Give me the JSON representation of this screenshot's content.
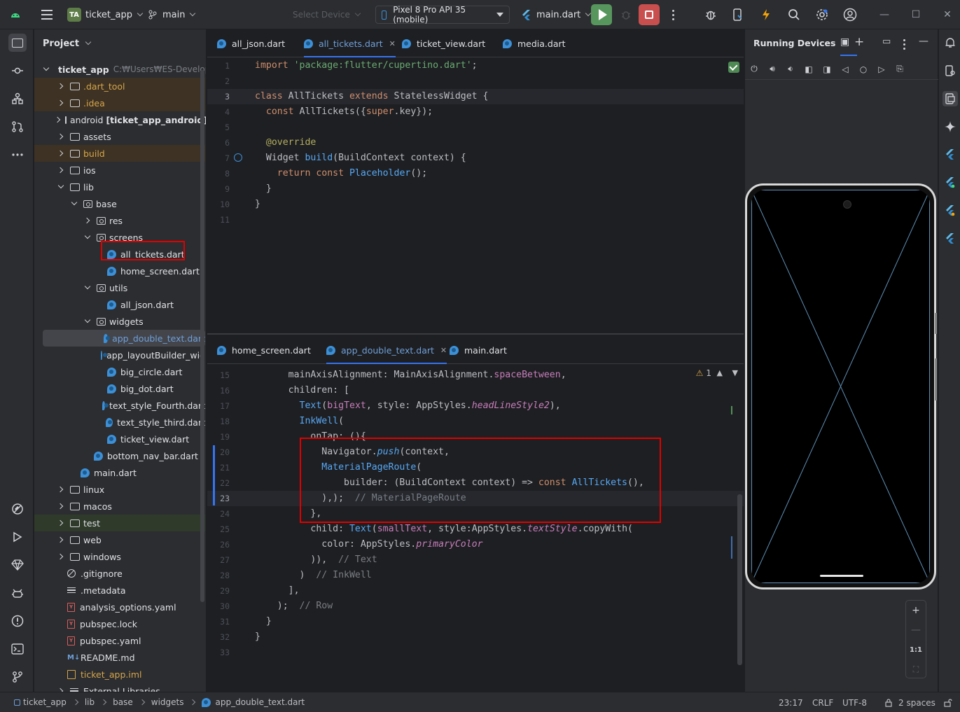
{
  "titlebar": {
    "project_badge": "TA",
    "project_name": "ticket_app",
    "branch": "main",
    "select_device_placeholder": "Select Device",
    "device": "Pixel 8 Pro API 35 (mobile)",
    "run_config": "main.dart"
  },
  "project_panel": {
    "title": "Project",
    "tree": [
      {
        "label": "ticket_app",
        "extra": "C:₩Users₩ES-Develope",
        "depth": 0,
        "arrow": "d",
        "icon": "flutter"
      },
      {
        "label": ".dart_tool",
        "depth": 1,
        "arrow": "r",
        "icon": "folder",
        "style": "excluded"
      },
      {
        "label": ".idea",
        "depth": 1,
        "arrow": "r",
        "icon": "folder",
        "style": "excluded"
      },
      {
        "label": "android",
        "bold": "[ticket_app_android]",
        "depth": 1,
        "arrow": "r",
        "icon": "folder"
      },
      {
        "label": "assets",
        "depth": 1,
        "arrow": "r",
        "icon": "folder"
      },
      {
        "label": "build",
        "depth": 1,
        "arrow": "r",
        "icon": "folder",
        "style": "excluded"
      },
      {
        "label": "ios",
        "depth": 1,
        "arrow": "r",
        "icon": "folder"
      },
      {
        "label": "lib",
        "depth": 1,
        "arrow": "d",
        "icon": "folder"
      },
      {
        "label": "base",
        "depth": 2,
        "arrow": "d",
        "icon": "pkg"
      },
      {
        "label": "res",
        "depth": 3,
        "arrow": "r",
        "icon": "pkg"
      },
      {
        "label": "screens",
        "depth": 3,
        "arrow": "d",
        "icon": "pkg"
      },
      {
        "label": "all_tickets.dart",
        "depth": 4,
        "arrow": "none",
        "icon": "dart"
      },
      {
        "label": "home_screen.dart",
        "depth": 4,
        "arrow": "none",
        "icon": "dart"
      },
      {
        "label": "utils",
        "depth": 3,
        "arrow": "d",
        "icon": "pkg"
      },
      {
        "label": "all_json.dart",
        "depth": 4,
        "arrow": "none",
        "icon": "dart"
      },
      {
        "label": "widgets",
        "depth": 3,
        "arrow": "d",
        "icon": "pkg"
      },
      {
        "label": "app_double_text.dart",
        "depth": 4,
        "arrow": "none",
        "icon": "dart",
        "style": "selected"
      },
      {
        "label": "app_layoutBuilder_wid",
        "depth": 4,
        "arrow": "none",
        "icon": "dart"
      },
      {
        "label": "big_circle.dart",
        "depth": 4,
        "arrow": "none",
        "icon": "dart"
      },
      {
        "label": "big_dot.dart",
        "depth": 4,
        "arrow": "none",
        "icon": "dart"
      },
      {
        "label": "text_style_Fourth.dart",
        "depth": 4,
        "arrow": "none",
        "icon": "dart"
      },
      {
        "label": "text_style_third.dart",
        "depth": 4,
        "arrow": "none",
        "icon": "dart"
      },
      {
        "label": "ticket_view.dart",
        "depth": 4,
        "arrow": "none",
        "icon": "dart"
      },
      {
        "label": "bottom_nav_bar.dart",
        "depth": 3,
        "arrow": "none",
        "icon": "dart"
      },
      {
        "label": "main.dart",
        "depth": 2,
        "arrow": "none",
        "icon": "dart"
      },
      {
        "label": "linux",
        "depth": 1,
        "arrow": "r",
        "icon": "folder"
      },
      {
        "label": "macos",
        "depth": 1,
        "arrow": "r",
        "icon": "folder"
      },
      {
        "label": "test",
        "depth": 1,
        "arrow": "r",
        "icon": "folder",
        "style": "test"
      },
      {
        "label": "web",
        "depth": 1,
        "arrow": "r",
        "icon": "folder"
      },
      {
        "label": "windows",
        "depth": 1,
        "arrow": "r",
        "icon": "folder"
      },
      {
        "label": ".gitignore",
        "depth": 1,
        "arrow": "none",
        "icon": "noentry"
      },
      {
        "label": ".metadata",
        "depth": 1,
        "arrow": "none",
        "icon": "lines"
      },
      {
        "label": "analysis_options.yaml",
        "depth": 1,
        "arrow": "none",
        "icon": "yaml"
      },
      {
        "label": "pubspec.lock",
        "depth": 1,
        "arrow": "none",
        "icon": "yaml"
      },
      {
        "label": "pubspec.yaml",
        "depth": 1,
        "arrow": "none",
        "icon": "yaml"
      },
      {
        "label": "README.md",
        "depth": 1,
        "arrow": "none",
        "icon": "md"
      },
      {
        "label": "ticket_app.iml",
        "depth": 1,
        "arrow": "none",
        "icon": "iml",
        "style": "orange"
      },
      {
        "label": "External Libraries",
        "depth": 1,
        "arrow": "r",
        "icon": "lines"
      }
    ]
  },
  "top_editor": {
    "tabs": [
      {
        "label": "all_json.dart",
        "active": false
      },
      {
        "label": "all_tickets.dart",
        "active": true
      },
      {
        "label": "ticket_view.dart",
        "active": false
      },
      {
        "label": "media.dart",
        "active": false
      }
    ],
    "current_line": 3,
    "lines": [
      {
        "n": "1",
        "code": [
          [
            "k",
            "import "
          ],
          [
            "s",
            "'package:flutter/cupertino.dart'"
          ],
          [
            "t",
            ";"
          ]
        ]
      },
      {
        "n": "2",
        "code": []
      },
      {
        "n": "3",
        "code": [
          [
            "k",
            "class "
          ],
          [
            "t",
            "AllTickets "
          ],
          [
            "k",
            "extends "
          ],
          [
            "t",
            "StatelessWidget {"
          ]
        ]
      },
      {
        "n": "4",
        "code": [
          [
            "t",
            "  "
          ],
          [
            "k",
            "const "
          ],
          [
            "t",
            "AllTickets({"
          ],
          [
            "k",
            "super"
          ],
          [
            "t",
            ".key});"
          ]
        ]
      },
      {
        "n": "5",
        "code": []
      },
      {
        "n": "6",
        "code": [
          [
            "t",
            "  "
          ],
          [
            "ann",
            "@override"
          ]
        ]
      },
      {
        "n": "7",
        "code": [
          [
            "t",
            "  Widget "
          ],
          [
            "f",
            "build"
          ],
          [
            "t",
            "(BuildContext context) {"
          ]
        ]
      },
      {
        "n": "8",
        "code": [
          [
            "t",
            "    "
          ],
          [
            "k",
            "return const "
          ],
          [
            "f",
            "Placeholder"
          ],
          [
            "t",
            "();"
          ]
        ]
      },
      {
        "n": "9",
        "code": [
          [
            "t",
            "  }"
          ]
        ]
      },
      {
        "n": "10",
        "code": [
          [
            "t",
            "}"
          ]
        ]
      },
      {
        "n": "11",
        "code": []
      }
    ]
  },
  "bottom_editor": {
    "tabs": [
      {
        "label": "home_screen.dart",
        "active": false
      },
      {
        "label": "app_double_text.dart",
        "active": true
      },
      {
        "label": "main.dart",
        "active": false
      }
    ],
    "warning_count": "1",
    "current_line": 23,
    "lines": [
      {
        "n": "15",
        "code": [
          [
            "t",
            "      mainAxisAlignment: MainAxisAlignment."
          ],
          [
            "p",
            "spaceBetween"
          ],
          [
            "t",
            ","
          ]
        ]
      },
      {
        "n": "16",
        "code": [
          [
            "t",
            "      children: ["
          ]
        ]
      },
      {
        "n": "17",
        "code": [
          [
            "t",
            "        "
          ],
          [
            "f",
            "Text"
          ],
          [
            "t",
            "("
          ],
          [
            "p",
            "bigText"
          ],
          [
            "t",
            ", style: AppStyles."
          ],
          [
            "pi",
            "headLineStyle2"
          ],
          [
            "t",
            "),"
          ]
        ]
      },
      {
        "n": "18",
        "code": [
          [
            "t",
            "        "
          ],
          [
            "f",
            "InkWell"
          ],
          [
            "t",
            "("
          ]
        ]
      },
      {
        "n": "19",
        "code": [
          [
            "t",
            "          onTap: (){"
          ]
        ]
      },
      {
        "n": "20",
        "code": [
          [
            "t",
            "            Navigator."
          ],
          [
            "mi",
            "push"
          ],
          [
            "t",
            "(context,"
          ]
        ]
      },
      {
        "n": "21",
        "code": [
          [
            "t",
            "            "
          ],
          [
            "f",
            "MaterialPageRoute"
          ],
          [
            "t",
            "("
          ]
        ]
      },
      {
        "n": "22",
        "code": [
          [
            "t",
            "                builder: (BuildContext context) => "
          ],
          [
            "k",
            "const "
          ],
          [
            "f",
            "AllTickets"
          ],
          [
            "t",
            "(),"
          ]
        ]
      },
      {
        "n": "23",
        "code": [
          [
            "t",
            "            ),);  "
          ],
          [
            "c",
            "// MaterialPageRoute"
          ]
        ]
      },
      {
        "n": "24",
        "code": [
          [
            "t",
            "          },"
          ]
        ]
      },
      {
        "n": "25",
        "code": [
          [
            "t",
            "          child: "
          ],
          [
            "f",
            "Text"
          ],
          [
            "t",
            "("
          ],
          [
            "p",
            "smallText"
          ],
          [
            "t",
            ", style:AppStyles."
          ],
          [
            "pi",
            "textStyle"
          ],
          [
            "t",
            ".copyWith("
          ]
        ]
      },
      {
        "n": "26",
        "code": [
          [
            "t",
            "            color: AppStyles."
          ],
          [
            "pi",
            "primaryColor"
          ]
        ]
      },
      {
        "n": "27",
        "code": [
          [
            "t",
            "          )),  "
          ],
          [
            "c",
            "// Text"
          ]
        ]
      },
      {
        "n": "28",
        "code": [
          [
            "t",
            "        )  "
          ],
          [
            "c",
            "// InkWell"
          ]
        ]
      },
      {
        "n": "29",
        "code": [
          [
            "t",
            "      ],"
          ]
        ]
      },
      {
        "n": "30",
        "code": [
          [
            "t",
            "    );  "
          ],
          [
            "c",
            "// Row"
          ]
        ]
      },
      {
        "n": "31",
        "code": [
          [
            "t",
            "  }"
          ]
        ]
      },
      {
        "n": "32",
        "code": [
          [
            "t",
            "}"
          ]
        ]
      },
      {
        "n": "33",
        "code": []
      }
    ]
  },
  "devices_panel": {
    "title": "Running Devices",
    "zoom_reset_label": "1:1"
  },
  "statusbar": {
    "breadcrumb": [
      "ticket_app",
      "lib",
      "base",
      "widgets",
      "app_double_text.dart"
    ],
    "position": "23:17",
    "line_separator": "CRLF",
    "encoding": "UTF-8",
    "indent": "2 spaces"
  },
  "colors": {
    "accent": "#3574f0",
    "run": "#57965c",
    "stop": "#c94f4f",
    "highlight_box": "#e00000"
  }
}
